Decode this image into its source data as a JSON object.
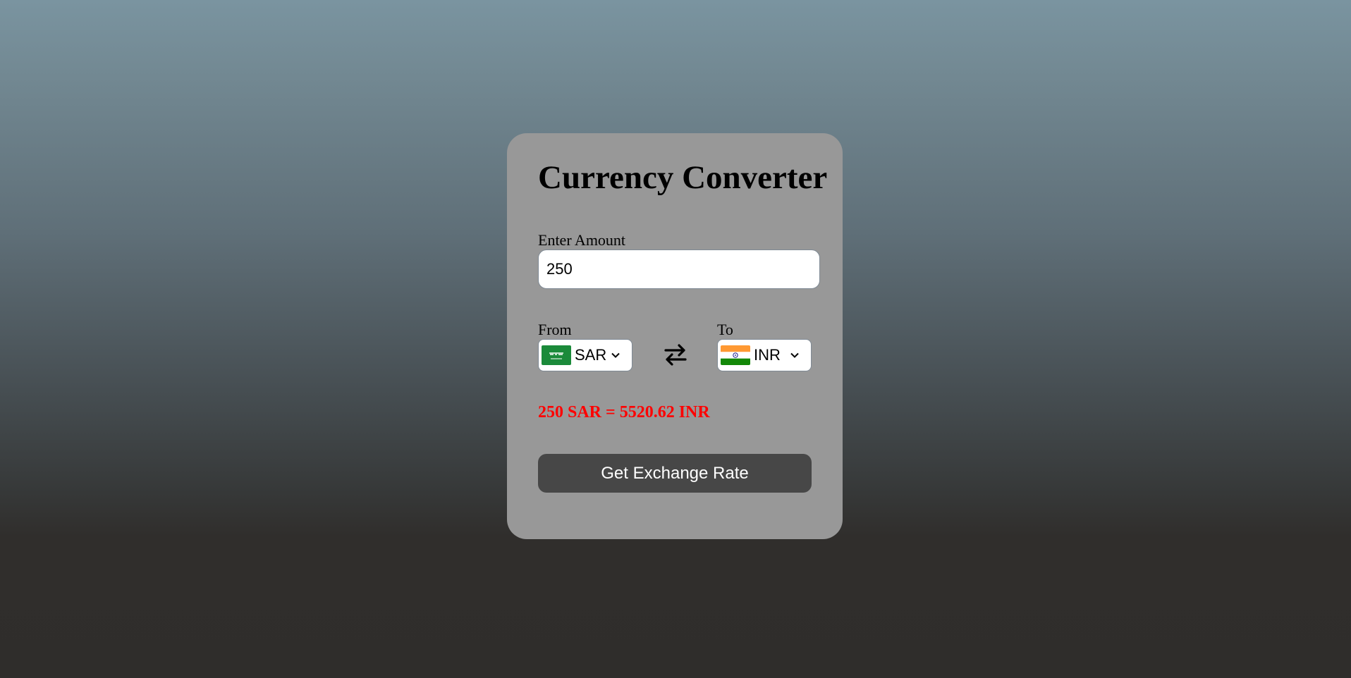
{
  "card": {
    "title": "Currency Converter",
    "amount_label": "Enter Amount",
    "amount_value": "250",
    "from_label": "From",
    "to_label": "To",
    "from_currency": {
      "code": "SAR",
      "flag_icon": "saudi-arabia-flag"
    },
    "to_currency": {
      "code": "INR",
      "flag_icon": "india-flag"
    },
    "swap_icon": "swap-arrows-icon",
    "result_text": "250 SAR = 5520.62 INR",
    "button_label": "Get Exchange Rate"
  },
  "colors": {
    "card_bg": "#989898",
    "result": "#ff0000",
    "button_bg": "#474747",
    "button_text": "#ffffff"
  }
}
